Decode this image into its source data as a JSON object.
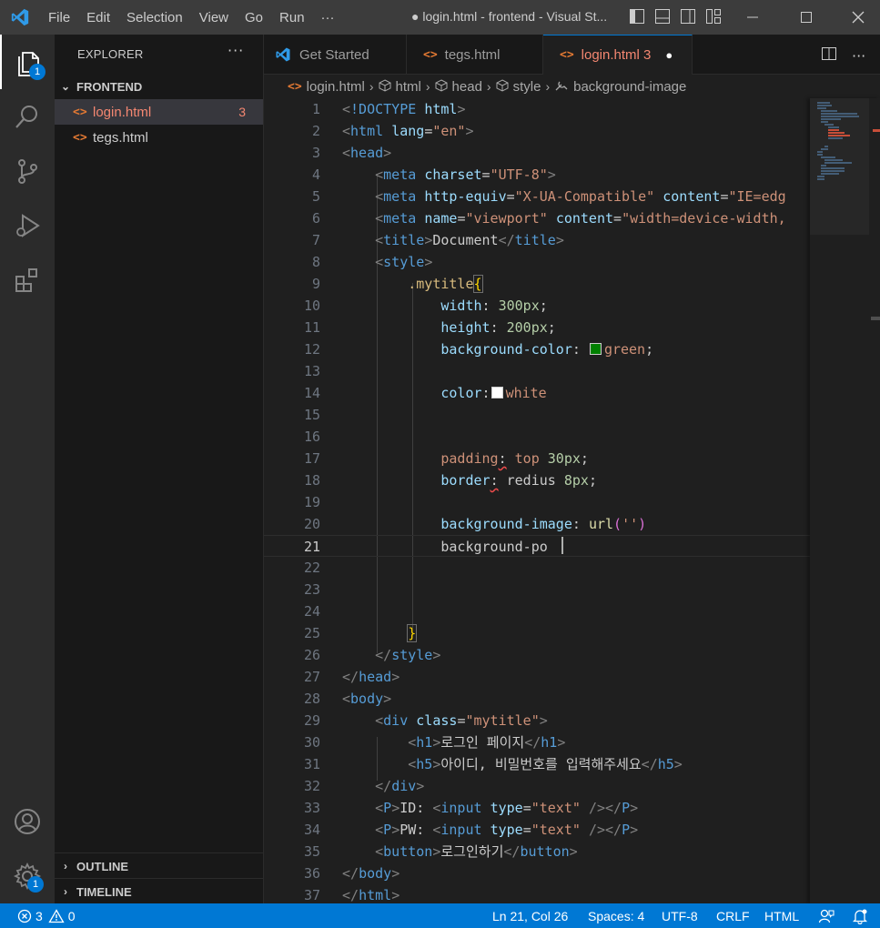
{
  "titlebar": {
    "menu": [
      "File",
      "Edit",
      "Selection",
      "View",
      "Go",
      "Run",
      "···"
    ],
    "title": "● login.html - frontend - Visual St..."
  },
  "activity": {
    "explorer_badge": "1",
    "settings_badge": "1"
  },
  "sidebar": {
    "header": "EXPLORER",
    "more": "···",
    "folder": "FRONTEND",
    "files": [
      {
        "name": "login.html",
        "problems": "3",
        "icon": "<>"
      },
      {
        "name": "tegs.html",
        "problems": "",
        "icon": "<>"
      }
    ],
    "outline": "OUTLINE",
    "timeline": "TIMELINE"
  },
  "tabs": [
    {
      "label": "Get Started",
      "icon": "vscode-logo-icon"
    },
    {
      "label": "tegs.html",
      "icon": "<>"
    },
    {
      "label": "login.html 3",
      "icon": "<>",
      "dirty": "●"
    }
  ],
  "breadcrumb": [
    "login.html",
    "html",
    "head",
    "style",
    "background-image"
  ],
  "editor": {
    "current_line": "21",
    "lines": [
      {
        "n": "1"
      },
      {
        "n": "2"
      },
      {
        "n": "3"
      },
      {
        "n": "4"
      },
      {
        "n": "5"
      },
      {
        "n": "6"
      },
      {
        "n": "7"
      },
      {
        "n": "8"
      },
      {
        "n": "9"
      },
      {
        "n": "10"
      },
      {
        "n": "11"
      },
      {
        "n": "12"
      },
      {
        "n": "13"
      },
      {
        "n": "14"
      },
      {
        "n": "15"
      },
      {
        "n": "16"
      },
      {
        "n": "17"
      },
      {
        "n": "18"
      },
      {
        "n": "19"
      },
      {
        "n": "20"
      },
      {
        "n": "21"
      },
      {
        "n": "22"
      },
      {
        "n": "23"
      },
      {
        "n": "24"
      },
      {
        "n": "25"
      },
      {
        "n": "26"
      },
      {
        "n": "27"
      },
      {
        "n": "28"
      },
      {
        "n": "29"
      },
      {
        "n": "30"
      },
      {
        "n": "31"
      },
      {
        "n": "32"
      },
      {
        "n": "33"
      },
      {
        "n": "34"
      },
      {
        "n": "35"
      },
      {
        "n": "36"
      },
      {
        "n": "37"
      }
    ],
    "code": {
      "l1": "!DOCTYPE",
      "l1b": "html",
      "l5_val": "\"IE=edg",
      "l6_val": "\"width=device-width,",
      "l7_text": "Document",
      "l9_sel": ".mytitle",
      "l10_prop": "width",
      "l10_val": "300px",
      "l11_prop": "height",
      "l11_val": "200px",
      "l12_prop": "background-color",
      "l12_val": "green",
      "l12_swatch": "#008000",
      "l14_prop": "color",
      "l14_val": "white",
      "l14_swatch": "#ffffff",
      "l17_prop": "padding",
      "l17_val1": "top",
      "l17_val2": "30px",
      "l18_prop": "border",
      "l18_val1": "redius",
      "l18_val2": "8px",
      "l20_prop": "background-image",
      "l20_fn": "url",
      "l20_arg": "''",
      "l21_text": "background-po",
      "l29_attr": "class",
      "l29_val": "\"mytitle\"",
      "l30_text": "로그인 페이지",
      "l31_text": "아이디, 비밀번호를 입력해주세요",
      "l33_label": "ID: ",
      "l34_label": "PW: ",
      "input_type": "\"text\"",
      "l35_text": "로그인하기"
    }
  },
  "statusbar": {
    "errors": "3",
    "warnings": "0",
    "position": "Ln 21, Col 26",
    "spaces": "Spaces: 4",
    "encoding": "UTF-8",
    "eol": "CRLF",
    "language": "HTML"
  },
  "colors": {
    "accent": "#0078d4",
    "error": "#f48771",
    "statusbar": "#0078d4"
  }
}
